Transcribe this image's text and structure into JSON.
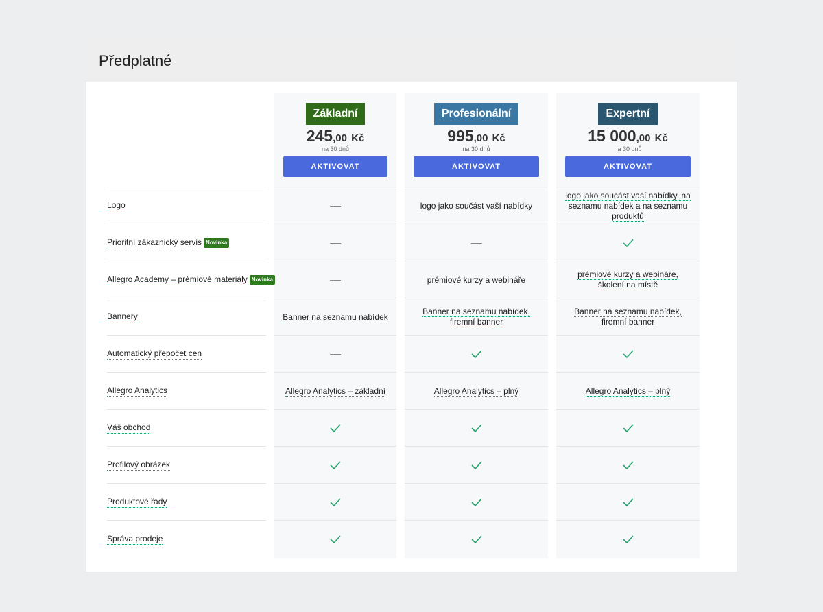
{
  "page": {
    "title": "Předplatné"
  },
  "plans": [
    {
      "name": "Základní",
      "price_int": "245",
      "price_dec": ",00",
      "currency": "Kč",
      "period": "na 30 dnů",
      "button": "AKTIVOVAT",
      "color": "#2f6b18"
    },
    {
      "name": "Profesionální",
      "price_int": "995",
      "price_dec": ",00",
      "currency": "Kč",
      "period": "na 30 dnů",
      "button": "AKTIVOVAT",
      "color": "#3a77a3"
    },
    {
      "name": "Expertní",
      "price_int": "15 000",
      "price_dec": ",00",
      "currency": "Kč",
      "period": "na 30 dnů",
      "button": "AKTIVOVAT",
      "color": "#2b5670"
    }
  ],
  "new_badge": "Novinka",
  "features": [
    {
      "label": "Logo",
      "new": false,
      "values": [
        "-",
        "logo jako součást vaší nabídky",
        "logo jako součást vaší nabídky, na seznamu nabídek a na seznamu produktů"
      ]
    },
    {
      "label": "Prioritní zákaznický servis",
      "new": true,
      "values": [
        "-",
        "-",
        "check"
      ]
    },
    {
      "label": "Allegro Academy – prémiové materiály",
      "new": true,
      "values": [
        "-",
        "prémiové kurzy a webináře",
        "prémiové kurzy a webináře, školení na místě"
      ]
    },
    {
      "label": "Bannery",
      "new": false,
      "values": [
        "Banner na seznamu nabídek",
        "Banner na seznamu nabídek, firemní banner",
        "Banner na seznamu nabídek, firemní banner"
      ]
    },
    {
      "label": "Automatický přepočet cen",
      "new": false,
      "values": [
        "-",
        "check",
        "check"
      ]
    },
    {
      "label": "Allegro Analytics",
      "new": false,
      "values": [
        "Allegro Analytics – základní",
        "Allegro Analytics – plný",
        "Allegro Analytics – plný"
      ]
    },
    {
      "label": "Váš obchod",
      "new": false,
      "values": [
        "check",
        "check",
        "check"
      ]
    },
    {
      "label": "Profilový obrázek",
      "new": false,
      "values": [
        "check",
        "check",
        "check"
      ]
    },
    {
      "label": "Produktové řady",
      "new": false,
      "values": [
        "check",
        "check",
        "check"
      ]
    },
    {
      "label": "Správa prodeje",
      "new": false,
      "values": [
        "check",
        "check",
        "check"
      ]
    }
  ],
  "icons": {
    "check": "check-icon",
    "dash": "dash-icon"
  },
  "colors": {
    "accent_button": "#4a69dd",
    "check": "#23a36b",
    "new_badge": "#2f7a1f"
  }
}
